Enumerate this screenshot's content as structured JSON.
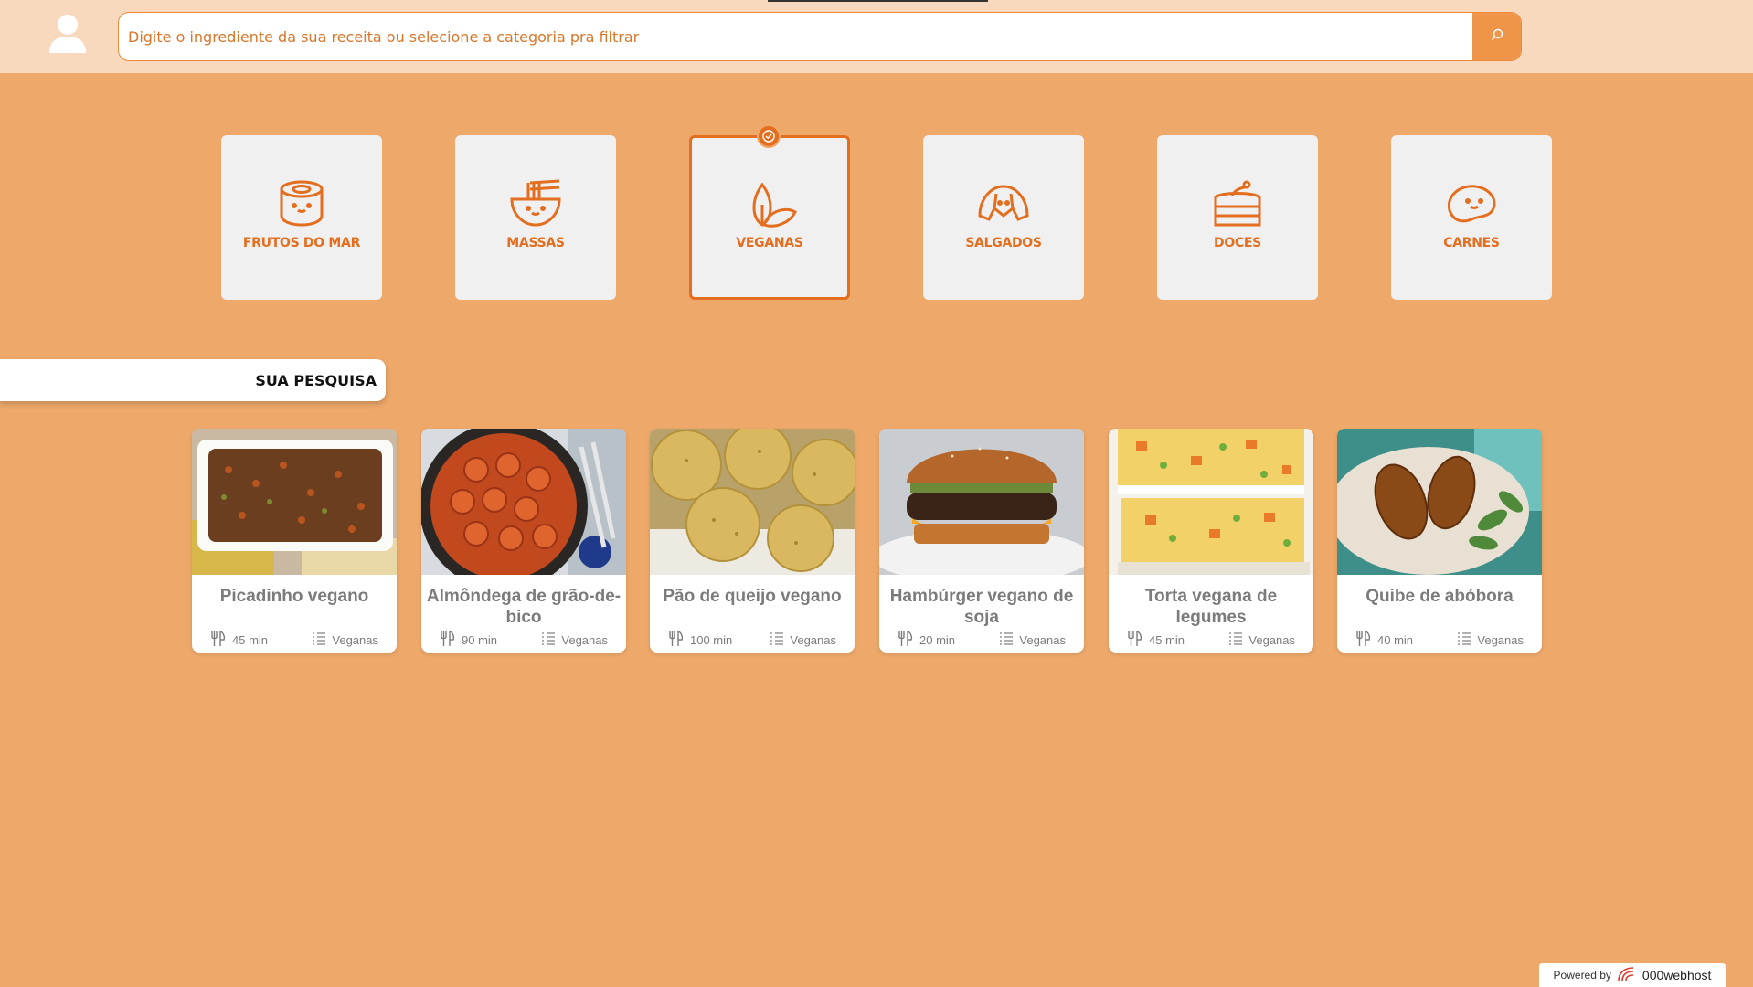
{
  "header": {
    "search_placeholder": "Digite o ingrediente da sua receita ou selecione a categoria pra filtrar"
  },
  "categories": [
    {
      "label": "FRUTOS DO MAR",
      "icon": "sushi-icon",
      "selected": false
    },
    {
      "label": "MASSAS",
      "icon": "noodle-bowl-icon",
      "selected": false
    },
    {
      "label": "VEGANAS",
      "icon": "leaf-icon",
      "selected": true
    },
    {
      "label": "SALGADOS",
      "icon": "croissant-icon",
      "selected": false
    },
    {
      "label": "DOCES",
      "icon": "cake-icon",
      "selected": false
    },
    {
      "label": "CARNES",
      "icon": "steak-icon",
      "selected": false
    }
  ],
  "section": {
    "title": "SUA PESQUISA"
  },
  "recipes": [
    {
      "title": "Picadinho vegano",
      "time": "45 min",
      "category": "Veganas"
    },
    {
      "title": "Almôndega de grão-de-bico",
      "time": "90 min",
      "category": "Veganas"
    },
    {
      "title": "Pão de queijo vegano",
      "time": "100 min",
      "category": "Veganas"
    },
    {
      "title": "Hambúrger vegano de soja",
      "time": "20 min",
      "category": "Veganas"
    },
    {
      "title": "Torta vegana de legumes",
      "time": "45 min",
      "category": "Veganas"
    },
    {
      "title": "Quibe de abóbora",
      "time": "40 min",
      "category": "Veganas"
    }
  ],
  "footer": {
    "powered_by": "Powered by",
    "brand": "000webhost"
  },
  "colors": {
    "background": "#EDA86A",
    "accent": "#E36E1F",
    "topbar": "#F8D9BE"
  }
}
